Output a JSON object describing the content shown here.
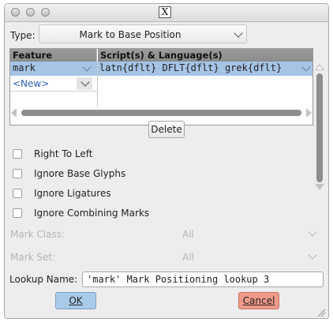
{
  "window": {
    "title_icon": "x-window-icon"
  },
  "type_row": {
    "label": "Type:",
    "selected": "Mark to Base Position"
  },
  "table": {
    "headers": {
      "feature": "Feature",
      "scripts": "Script(s) & Language(s)"
    },
    "rows": [
      {
        "feature": "mark",
        "scripts": "latn{dflt} DFLT{dflt} grek{dflt}"
      }
    ],
    "new_entry": "<New>"
  },
  "delete_button": "Delete",
  "checkboxes": [
    {
      "label": "Right To Left",
      "checked": false
    },
    {
      "label": "Ignore Base Glyphs",
      "checked": false
    },
    {
      "label": "Ignore Ligatures",
      "checked": false
    },
    {
      "label": "Ignore Combining Marks",
      "checked": false
    }
  ],
  "mark_class": {
    "label": "Mark Class:",
    "value": "All"
  },
  "mark_set": {
    "label": "Mark Set:",
    "value": "All"
  },
  "lookup_name": {
    "label": "Lookup Name:",
    "value": "'mark' Mark Positioning lookup 3"
  },
  "buttons": {
    "ok": "OK",
    "cancel": "Cancel"
  },
  "colors": {
    "ok_bg": "#a9cbea",
    "cancel_bg": "#f09a8a",
    "selection": "#a5c4e6",
    "link_blue": "#2d5fc4"
  }
}
